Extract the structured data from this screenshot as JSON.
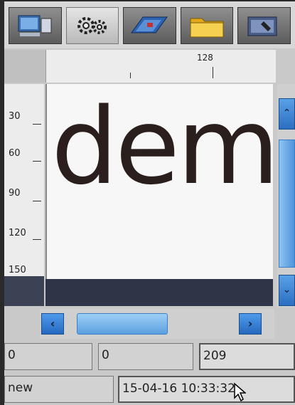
{
  "toolbar": {
    "tabs": [
      {
        "name": "computer-icon",
        "active": false
      },
      {
        "name": "gears-icon",
        "active": true
      },
      {
        "name": "blueprint-icon",
        "active": false
      },
      {
        "name": "folder-icon",
        "active": false
      },
      {
        "name": "tool-icon",
        "active": false
      }
    ]
  },
  "ruler": {
    "h_label": "128",
    "v_labels": [
      "30",
      "60",
      "90",
      "120",
      "150"
    ]
  },
  "canvas": {
    "text": "demo"
  },
  "fields": {
    "field_x": "0",
    "field_y": "0",
    "field_length": "209",
    "status": "new",
    "datetime": "15-04-16 10:33:32"
  },
  "colors": {
    "scroll_accent": "#2c6fc2",
    "text_dark": "#2a1f1c"
  },
  "icons": {
    "scroll_up": "chevron-up-icon",
    "scroll_down": "chevron-down-icon",
    "scroll_left": "chevron-left-icon",
    "scroll_right": "chevron-right-icon"
  }
}
